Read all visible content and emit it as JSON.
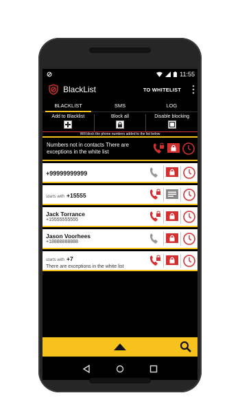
{
  "status": {
    "time": "11:55"
  },
  "appbar": {
    "title": "BlackList",
    "whitelist_label": "TO WHITELIST"
  },
  "tabs": [
    {
      "label": "BLACKLIST"
    },
    {
      "label": "SMS"
    },
    {
      "label": "LOG"
    }
  ],
  "actions": [
    {
      "label": "Add to Blacklist",
      "icon": "plus-icon"
    },
    {
      "label": "Block all",
      "icon": "lock-icon"
    },
    {
      "label": "Disable blocking",
      "icon": "square-icon"
    }
  ],
  "notice": "Will block the phone numbers added to the list below",
  "rule_header": "Numbers not in contacts There are exceptions in the white list",
  "rows": [
    {
      "title": "+99999999999",
      "prefix": "",
      "subtitle": ""
    },
    {
      "title": "+15555",
      "prefix": "starts with",
      "subtitle": ""
    },
    {
      "title": "Jack Torrance",
      "prefix": "",
      "subtitle": "+15555555555"
    },
    {
      "title": "Jason Voorhees",
      "prefix": "",
      "subtitle": "+18888888888"
    },
    {
      "title": "+7",
      "prefix": "starts with",
      "subtitle": "There are exceptions in the white list"
    }
  ],
  "colors": {
    "accent": "#f6c21b",
    "danger": "#d32f2f"
  }
}
